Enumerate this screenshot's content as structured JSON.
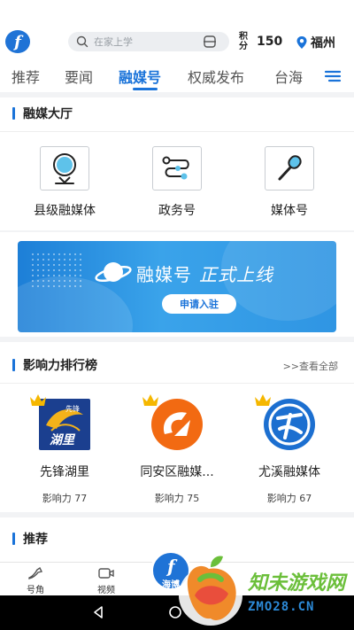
{
  "header": {
    "logo_text": "f",
    "search_placeholder": "在家上学",
    "points_label": "积分",
    "points_value": "150",
    "city": "福州"
  },
  "tabs": [
    {
      "label": "推荐",
      "active": false
    },
    {
      "label": "要闻",
      "active": false
    },
    {
      "label": "融媒号",
      "active": true
    },
    {
      "label": "权威发布",
      "active": false
    },
    {
      "label": "台海",
      "active": false
    }
  ],
  "hall": {
    "title": "融媒大厅",
    "items": [
      {
        "label": "县级融媒体",
        "icon": "pin-icon"
      },
      {
        "label": "政务号",
        "icon": "route-icon"
      },
      {
        "label": "媒体号",
        "icon": "microphone-icon"
      }
    ]
  },
  "banner": {
    "title": "融媒号",
    "title_em": "正式上线",
    "button": "申请入驻"
  },
  "ranking": {
    "title": "影响力排行榜",
    "more": ">>查看全部",
    "items": [
      {
        "name": "先锋湖里",
        "score": "影响力 77",
        "logo_text": "湖里",
        "logo_sub": "先锋"
      },
      {
        "name": "同安区融媒...",
        "score": "影响力 75"
      },
      {
        "name": "尤溪融媒体",
        "score": "影响力 67"
      }
    ]
  },
  "recommend": {
    "title": "推荐"
  },
  "bottom_nav": [
    {
      "label": "号角"
    },
    {
      "label": "视频"
    },
    {
      "label": "海博"
    }
  ],
  "watermark": {
    "line1": "知未游戏网",
    "line2": "ZMO28.CN"
  },
  "colors": {
    "accent": "#1a73d9",
    "watermark_green": "#6bbf3a",
    "watermark_blue": "#2c8ad8"
  }
}
